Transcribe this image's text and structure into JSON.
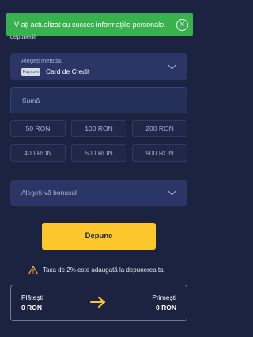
{
  "notification": {
    "message": "V-ați actualizat cu succes informațiile personale.",
    "close_symbol": "×",
    "background_color": "#37b24d"
  },
  "peek_text": "depunerii!",
  "payment_method": {
    "label": "Alegeți metoda:",
    "badge_text": "Psy.com",
    "name": "Card de Credit"
  },
  "amount": {
    "placeholder": "Sumă",
    "value": ""
  },
  "presets": [
    "50 RON",
    "100 RON",
    "200 RON",
    "400 RON",
    "500 RON",
    "900 RON"
  ],
  "bonus": {
    "label": "Alegeți-vă bonusul"
  },
  "deposit_button": {
    "label": "Depune",
    "color": "#fcc62d"
  },
  "fee_notice": "Taxa de 2% este adaugată la depunerea ta.",
  "summary": {
    "pay_label": "Plătești",
    "pay_value": "0 RON",
    "receive_label": "Primești",
    "receive_value": "0 RON",
    "arrow_color": "#fcc62d"
  },
  "icons": {
    "close": "close-circle-icon",
    "method_dropdown": "chevron-down-icon",
    "bonus_dropdown": "chevron-down-icon",
    "warning": "warning-icon",
    "transfer": "arrow-right-icon"
  },
  "colors": {
    "background": "#1b2340",
    "panel": "#2b3566",
    "accent": "#fcc62d"
  }
}
